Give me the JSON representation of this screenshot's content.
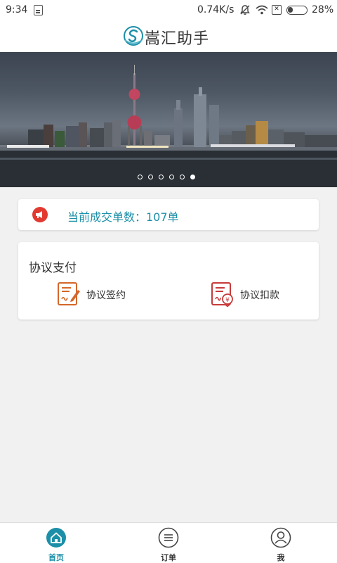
{
  "status_bar": {
    "time": "9:34",
    "network_speed": "0.74K/s",
    "sim_status": "✕",
    "battery_percent": "28%",
    "battery_level": 0.28
  },
  "header": {
    "title": "嵩汇助手",
    "logo_icon": "songhui-logo-icon"
  },
  "banner": {
    "slide_count": 6,
    "active_slide": 6
  },
  "notice": {
    "icon": "megaphone-icon",
    "text": "当前成交单数：107单",
    "accent_color": "#1c8fa8",
    "icon_color": "#e23a30"
  },
  "payment": {
    "heading": "协议支付",
    "items": [
      {
        "label": "协议签约",
        "icon": "contract-sign-icon"
      },
      {
        "label": "协议扣款",
        "icon": "contract-debit-icon"
      }
    ]
  },
  "bottom_nav": {
    "items": [
      {
        "label": "首页",
        "icon": "home-icon",
        "active": true
      },
      {
        "label": "订单",
        "icon": "orders-icon",
        "active": false
      },
      {
        "label": "我",
        "icon": "profile-icon",
        "active": false
      }
    ],
    "active_color": "#1c8fa8"
  }
}
